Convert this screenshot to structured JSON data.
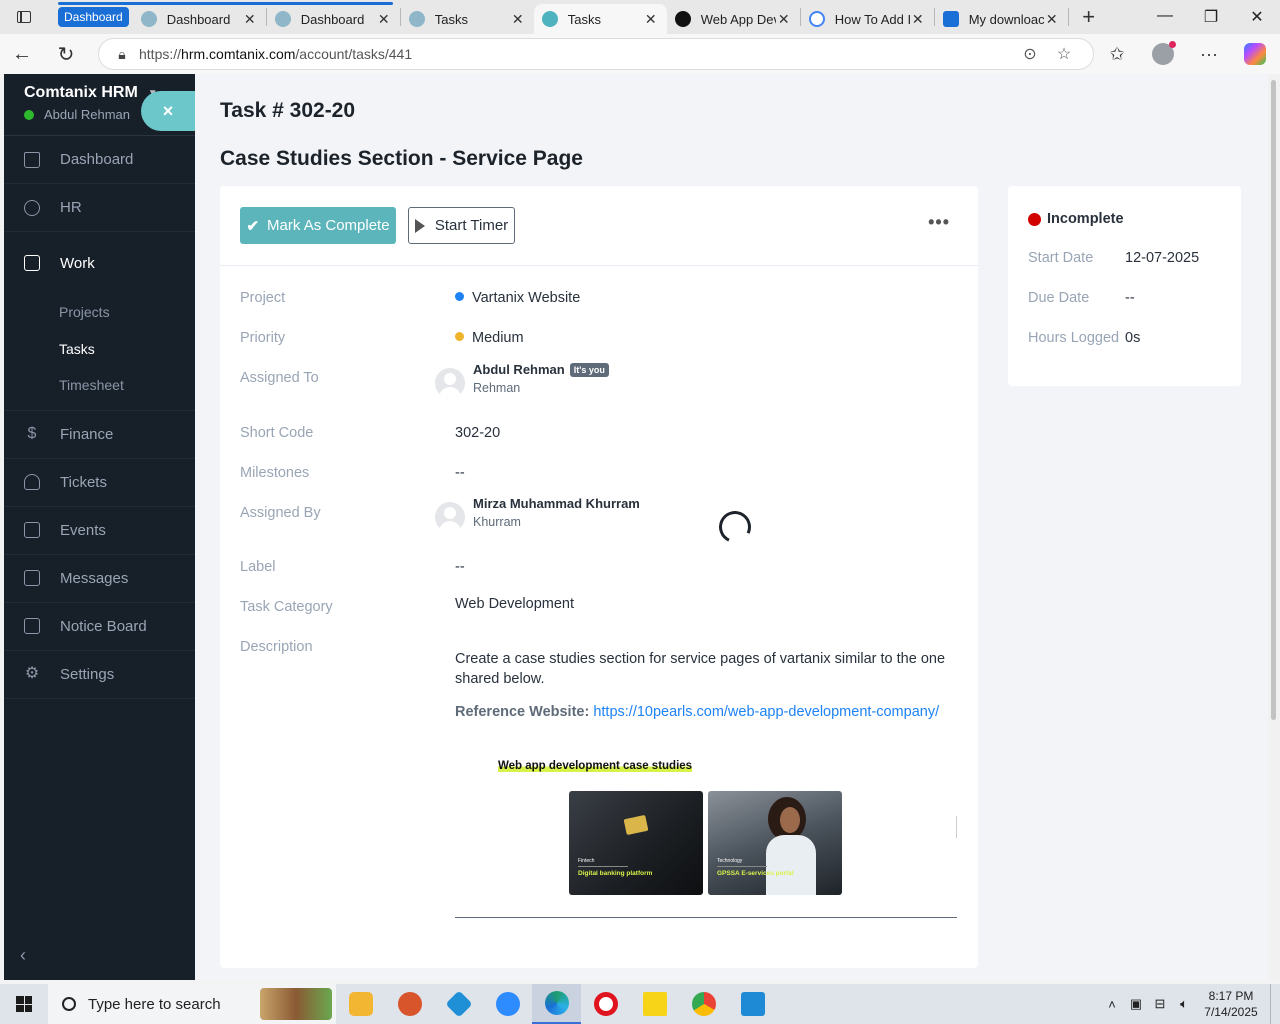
{
  "browser": {
    "tab_group_label": "Dashboard",
    "tabs": [
      {
        "title": "Dashboard",
        "favicon_color": "#8fb7c9"
      },
      {
        "title": "Dashboard",
        "favicon_color": "#8fb7c9"
      },
      {
        "title": "Tasks",
        "favicon_color": "#8fb7c9"
      },
      {
        "title": "Tasks",
        "favicon_color": "#4fb3bf",
        "active": true
      },
      {
        "title": "Web App Dev",
        "favicon_color": "#111111"
      },
      {
        "title": "How To Add I",
        "favicon_color": "#4285f4"
      },
      {
        "title": "My downloac",
        "favicon_color": "#1a6fd6"
      }
    ],
    "url_prefix": "https://",
    "url_host": "hrm.comtanix.com",
    "url_path": "/account/tasks/441"
  },
  "sidebar": {
    "app_name": "Comtanix HRM",
    "user_name": "Abdul Rehman",
    "close_label": "×",
    "items": [
      {
        "label": "Dashboard",
        "icon": "home-icon"
      },
      {
        "label": "HR",
        "icon": "users-icon"
      },
      {
        "label": "Work",
        "icon": "briefcase-icon",
        "active": true
      },
      {
        "label": "Finance",
        "icon": "dollar-icon"
      },
      {
        "label": "Tickets",
        "icon": "headset-icon"
      },
      {
        "label": "Events",
        "icon": "calendar-icon"
      },
      {
        "label": "Messages",
        "icon": "message-icon"
      },
      {
        "label": "Notice Board",
        "icon": "clipboard-icon"
      },
      {
        "label": "Settings",
        "icon": "gear-icon"
      }
    ],
    "work_submenu": [
      "Projects",
      "Tasks",
      "Timesheet"
    ],
    "active_submenu": "Tasks"
  },
  "task": {
    "id_title": "Task # 302-20",
    "heading": "Case Studies Section - Service Page",
    "mark_complete_label": "Mark As Complete",
    "start_timer_label": "Start Timer",
    "more_label": "•••",
    "fields": {
      "project_label": "Project",
      "project_value": "Vartanix Website",
      "priority_label": "Priority",
      "priority_value": "Medium",
      "assigned_to_label": "Assigned To",
      "assigned_to_name": "Abdul Rehman",
      "assigned_to_badge": "It's you",
      "assigned_to_sub": "Rehman",
      "short_code_label": "Short Code",
      "short_code_value": "302-20",
      "milestones_label": "Milestones",
      "milestones_value": "--",
      "assigned_by_label": "Assigned By",
      "assigned_by_name": "Mirza Muhammad Khurram",
      "assigned_by_sub": "Khurram",
      "label_label": "Label",
      "label_value": "--",
      "category_label": "Task Category",
      "category_value": "Web Development",
      "description_label": "Description"
    },
    "description": "Create a case studies section for service pages of vartanix similar to the one shared below.",
    "reference_label": "Reference Website:",
    "reference_url": "https://10pearls.com/web-app-development-company/",
    "embed": {
      "title": "Web app development case studies",
      "cards": [
        {
          "kicker": "Fintech",
          "title": "Digital banking platform"
        },
        {
          "kicker": "Technology",
          "title": "GPSSA E-services portal"
        }
      ]
    }
  },
  "status_card": {
    "status": "Incomplete",
    "status_color": "#d30000",
    "start_date_label": "Start Date",
    "start_date_value": "12-07-2025",
    "due_date_label": "Due Date",
    "due_date_value": "--",
    "hours_label": "Hours Logged",
    "hours_value": "0s"
  },
  "taskbar": {
    "search_placeholder": "Type here to search",
    "time": "8:17 PM",
    "date": "7/14/2025",
    "apps": [
      {
        "name": "file-explorer",
        "color": "#f2b632"
      },
      {
        "name": "app-2",
        "color": "#d8542b"
      },
      {
        "name": "app-3",
        "color": "#1f8fd6"
      },
      {
        "name": "zoom",
        "color": "#2d8cff"
      },
      {
        "name": "edge",
        "color": "#1e9d6e",
        "active": true
      },
      {
        "name": "opera",
        "color": "#e0141e"
      },
      {
        "name": "sticky-notes",
        "color": "#f7d417"
      },
      {
        "name": "chrome",
        "color": "#4285f4"
      },
      {
        "name": "vscode",
        "color": "#1e8ad6"
      }
    ]
  }
}
